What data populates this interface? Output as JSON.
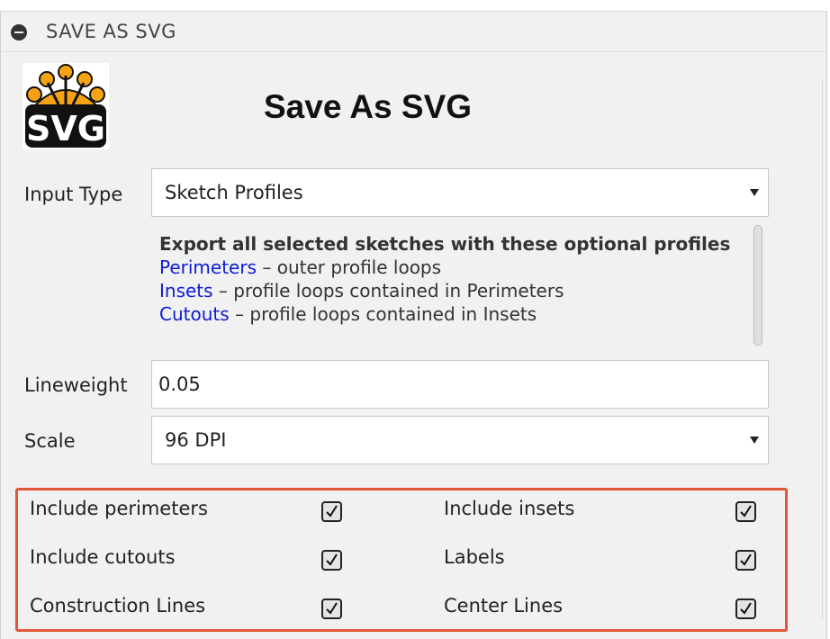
{
  "window": {
    "title": "SAVE AS SVG"
  },
  "header": {
    "logo_text": "SVG",
    "heading": "Save As SVG"
  },
  "input_type": {
    "label": "Input Type",
    "value": "Sketch Profiles"
  },
  "description": {
    "heading": "Export all selected sketches with these optional profiles",
    "lines": [
      {
        "term": "Perimeters",
        "text": " – outer profile loops"
      },
      {
        "term": "Insets",
        "text": " – profile loops contained in Perimeters"
      },
      {
        "term": "Cutouts",
        "text": " – profile loops contained in Insets"
      }
    ]
  },
  "lineweight": {
    "label": "Lineweight",
    "value": "0.05"
  },
  "scale": {
    "label": "Scale",
    "value": "96 DPI"
  },
  "options": {
    "highlight_color": "#e2573a",
    "items": [
      {
        "label": "Include perimeters",
        "checked": true
      },
      {
        "label": "Include insets",
        "checked": true
      },
      {
        "label": "Include cutouts",
        "checked": true
      },
      {
        "label": "Labels",
        "checked": true
      },
      {
        "label": "Construction Lines",
        "checked": true
      },
      {
        "label": "Center Lines",
        "checked": true
      }
    ]
  },
  "colors": {
    "link": "#0c1bd6",
    "logo_orange": "#f6a313"
  }
}
